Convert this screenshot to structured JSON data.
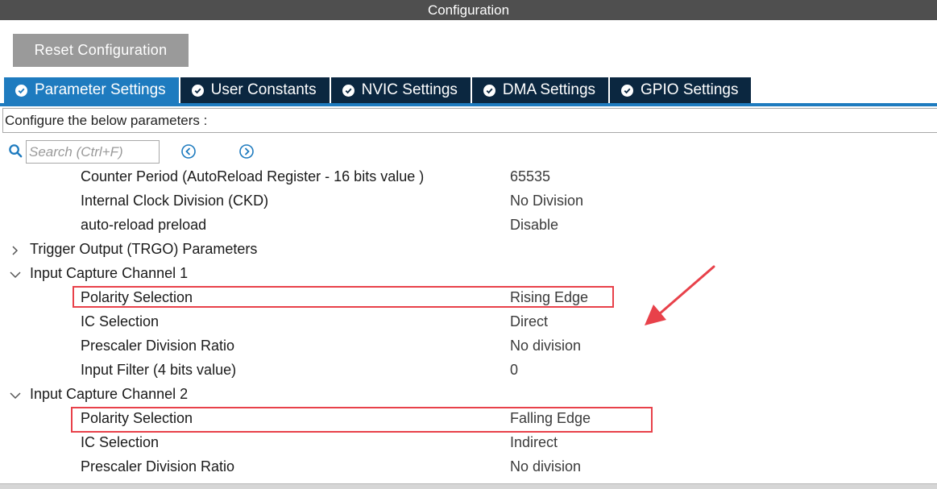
{
  "window": {
    "title": "Configuration"
  },
  "toolbar": {
    "reset_label": "Reset Configuration"
  },
  "tabs": [
    {
      "label": "Parameter Settings",
      "active": true
    },
    {
      "label": "User Constants",
      "active": false
    },
    {
      "label": "NVIC Settings",
      "active": false
    },
    {
      "label": "DMA Settings",
      "active": false
    },
    {
      "label": "GPIO Settings",
      "active": false
    }
  ],
  "description": "Configure the below parameters :",
  "search": {
    "placeholder": "Search (Ctrl+F)",
    "value": ""
  },
  "params": {
    "counter_period": {
      "label": "Counter Period (AutoReload Register - 16 bits value )",
      "value": "65535"
    },
    "clock_division": {
      "label": "Internal Clock Division (CKD)",
      "value": "No Division"
    },
    "autoreload": {
      "label": "auto-reload preload",
      "value": "Disable"
    },
    "trgo_group": {
      "label": "Trigger Output (TRGO) Parameters",
      "expanded": false
    },
    "ic1_group": {
      "label": "Input Capture Channel 1",
      "expanded": true
    },
    "ic1": {
      "polarity": {
        "label": "Polarity Selection",
        "value": "Rising Edge"
      },
      "selection": {
        "label": "IC Selection",
        "value": "Direct"
      },
      "prescaler": {
        "label": "Prescaler Division Ratio",
        "value": "No division"
      },
      "filter": {
        "label": "Input Filter (4 bits value)",
        "value": "0"
      }
    },
    "ic2_group": {
      "label": "Input Capture Channel 2",
      "expanded": true
    },
    "ic2": {
      "polarity": {
        "label": "Polarity Selection",
        "value": "Falling Edge"
      },
      "selection": {
        "label": "IC Selection",
        "value": "Indirect"
      },
      "prescaler": {
        "label": "Prescaler Division Ratio",
        "value": "No division"
      }
    }
  },
  "colors": {
    "tab_active": "#1e7bbf",
    "tab_inactive": "#0b2740",
    "highlight": "#e8414a",
    "accent": "#1e7bbf"
  }
}
